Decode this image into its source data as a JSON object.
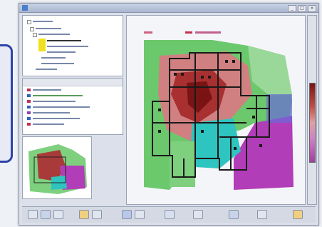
{
  "app": {
    "title": ""
  },
  "window_buttons": [
    "_",
    "□",
    "×"
  ],
  "colors": {
    "accent": "#2d44a8",
    "heat_high": "#8b1a1a",
    "heat_mid": "#e08080",
    "heat_low": "#69c86a",
    "heat_cyan": "#2ec4c0",
    "heat_magenta": "#b23db8"
  },
  "icons": {
    "tree_expand": "plus-box-icon",
    "toolbar": [
      "save-icon",
      "open-icon",
      "zoom-icon",
      "pan-icon",
      "select-icon",
      "print-icon"
    ]
  }
}
